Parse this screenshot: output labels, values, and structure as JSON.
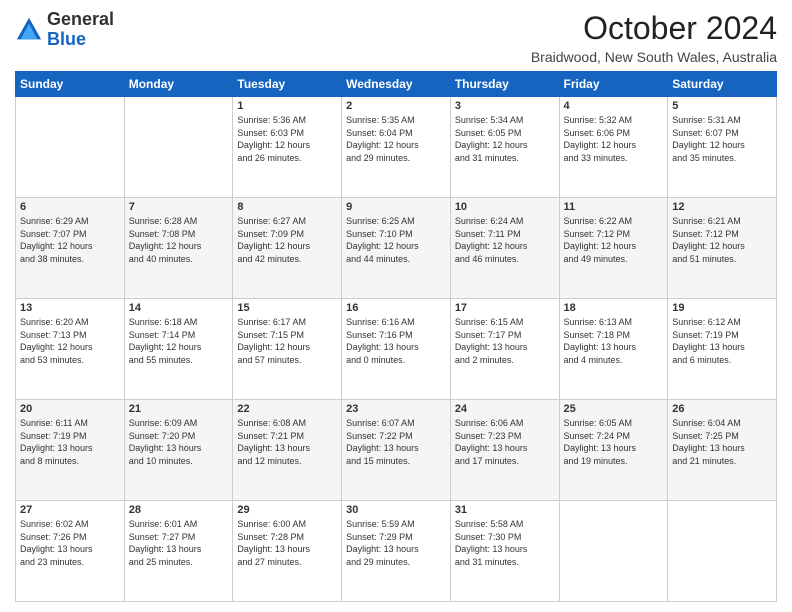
{
  "header": {
    "logo_general": "General",
    "logo_blue": "Blue",
    "month_title": "October 2024",
    "location": "Braidwood, New South Wales, Australia"
  },
  "days_of_week": [
    "Sunday",
    "Monday",
    "Tuesday",
    "Wednesday",
    "Thursday",
    "Friday",
    "Saturday"
  ],
  "weeks": [
    [
      {
        "day": "",
        "info": ""
      },
      {
        "day": "",
        "info": ""
      },
      {
        "day": "1",
        "info": "Sunrise: 5:36 AM\nSunset: 6:03 PM\nDaylight: 12 hours\nand 26 minutes."
      },
      {
        "day": "2",
        "info": "Sunrise: 5:35 AM\nSunset: 6:04 PM\nDaylight: 12 hours\nand 29 minutes."
      },
      {
        "day": "3",
        "info": "Sunrise: 5:34 AM\nSunset: 6:05 PM\nDaylight: 12 hours\nand 31 minutes."
      },
      {
        "day": "4",
        "info": "Sunrise: 5:32 AM\nSunset: 6:06 PM\nDaylight: 12 hours\nand 33 minutes."
      },
      {
        "day": "5",
        "info": "Sunrise: 5:31 AM\nSunset: 6:07 PM\nDaylight: 12 hours\nand 35 minutes."
      }
    ],
    [
      {
        "day": "6",
        "info": "Sunrise: 6:29 AM\nSunset: 7:07 PM\nDaylight: 12 hours\nand 38 minutes."
      },
      {
        "day": "7",
        "info": "Sunrise: 6:28 AM\nSunset: 7:08 PM\nDaylight: 12 hours\nand 40 minutes."
      },
      {
        "day": "8",
        "info": "Sunrise: 6:27 AM\nSunset: 7:09 PM\nDaylight: 12 hours\nand 42 minutes."
      },
      {
        "day": "9",
        "info": "Sunrise: 6:25 AM\nSunset: 7:10 PM\nDaylight: 12 hours\nand 44 minutes."
      },
      {
        "day": "10",
        "info": "Sunrise: 6:24 AM\nSunset: 7:11 PM\nDaylight: 12 hours\nand 46 minutes."
      },
      {
        "day": "11",
        "info": "Sunrise: 6:22 AM\nSunset: 7:12 PM\nDaylight: 12 hours\nand 49 minutes."
      },
      {
        "day": "12",
        "info": "Sunrise: 6:21 AM\nSunset: 7:12 PM\nDaylight: 12 hours\nand 51 minutes."
      }
    ],
    [
      {
        "day": "13",
        "info": "Sunrise: 6:20 AM\nSunset: 7:13 PM\nDaylight: 12 hours\nand 53 minutes."
      },
      {
        "day": "14",
        "info": "Sunrise: 6:18 AM\nSunset: 7:14 PM\nDaylight: 12 hours\nand 55 minutes."
      },
      {
        "day": "15",
        "info": "Sunrise: 6:17 AM\nSunset: 7:15 PM\nDaylight: 12 hours\nand 57 minutes."
      },
      {
        "day": "16",
        "info": "Sunrise: 6:16 AM\nSunset: 7:16 PM\nDaylight: 13 hours\nand 0 minutes."
      },
      {
        "day": "17",
        "info": "Sunrise: 6:15 AM\nSunset: 7:17 PM\nDaylight: 13 hours\nand 2 minutes."
      },
      {
        "day": "18",
        "info": "Sunrise: 6:13 AM\nSunset: 7:18 PM\nDaylight: 13 hours\nand 4 minutes."
      },
      {
        "day": "19",
        "info": "Sunrise: 6:12 AM\nSunset: 7:19 PM\nDaylight: 13 hours\nand 6 minutes."
      }
    ],
    [
      {
        "day": "20",
        "info": "Sunrise: 6:11 AM\nSunset: 7:19 PM\nDaylight: 13 hours\nand 8 minutes."
      },
      {
        "day": "21",
        "info": "Sunrise: 6:09 AM\nSunset: 7:20 PM\nDaylight: 13 hours\nand 10 minutes."
      },
      {
        "day": "22",
        "info": "Sunrise: 6:08 AM\nSunset: 7:21 PM\nDaylight: 13 hours\nand 12 minutes."
      },
      {
        "day": "23",
        "info": "Sunrise: 6:07 AM\nSunset: 7:22 PM\nDaylight: 13 hours\nand 15 minutes."
      },
      {
        "day": "24",
        "info": "Sunrise: 6:06 AM\nSunset: 7:23 PM\nDaylight: 13 hours\nand 17 minutes."
      },
      {
        "day": "25",
        "info": "Sunrise: 6:05 AM\nSunset: 7:24 PM\nDaylight: 13 hours\nand 19 minutes."
      },
      {
        "day": "26",
        "info": "Sunrise: 6:04 AM\nSunset: 7:25 PM\nDaylight: 13 hours\nand 21 minutes."
      }
    ],
    [
      {
        "day": "27",
        "info": "Sunrise: 6:02 AM\nSunset: 7:26 PM\nDaylight: 13 hours\nand 23 minutes."
      },
      {
        "day": "28",
        "info": "Sunrise: 6:01 AM\nSunset: 7:27 PM\nDaylight: 13 hours\nand 25 minutes."
      },
      {
        "day": "29",
        "info": "Sunrise: 6:00 AM\nSunset: 7:28 PM\nDaylight: 13 hours\nand 27 minutes."
      },
      {
        "day": "30",
        "info": "Sunrise: 5:59 AM\nSunset: 7:29 PM\nDaylight: 13 hours\nand 29 minutes."
      },
      {
        "day": "31",
        "info": "Sunrise: 5:58 AM\nSunset: 7:30 PM\nDaylight: 13 hours\nand 31 minutes."
      },
      {
        "day": "",
        "info": ""
      },
      {
        "day": "",
        "info": ""
      }
    ]
  ]
}
